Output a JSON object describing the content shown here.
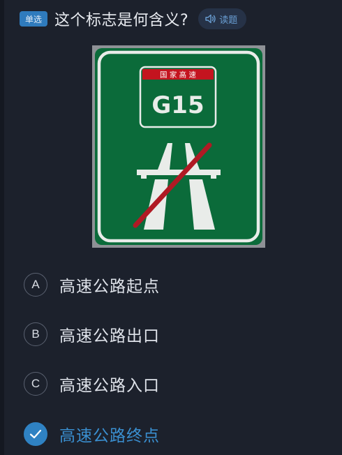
{
  "question": {
    "type_badge": "单选",
    "text": "这个标志是何含义?",
    "read_button_label": "读题"
  },
  "sign": {
    "banner_text": "国 家 高 速",
    "route_number": "G15",
    "colors": {
      "background": "#0b6b3a",
      "border": "#ffffff",
      "banner": "#c4141f",
      "strike": "#b01a24"
    }
  },
  "options": [
    {
      "letter": "A",
      "label": "高速公路起点",
      "selected": false
    },
    {
      "letter": "B",
      "label": "高速公路出口",
      "selected": false
    },
    {
      "letter": "C",
      "label": "高速公路入口",
      "selected": false
    },
    {
      "letter": "",
      "label": "高速公路终点",
      "selected": true,
      "icon": "check-icon"
    }
  ],
  "colors": {
    "accent": "#2f82c3",
    "background": "#1c212c"
  }
}
